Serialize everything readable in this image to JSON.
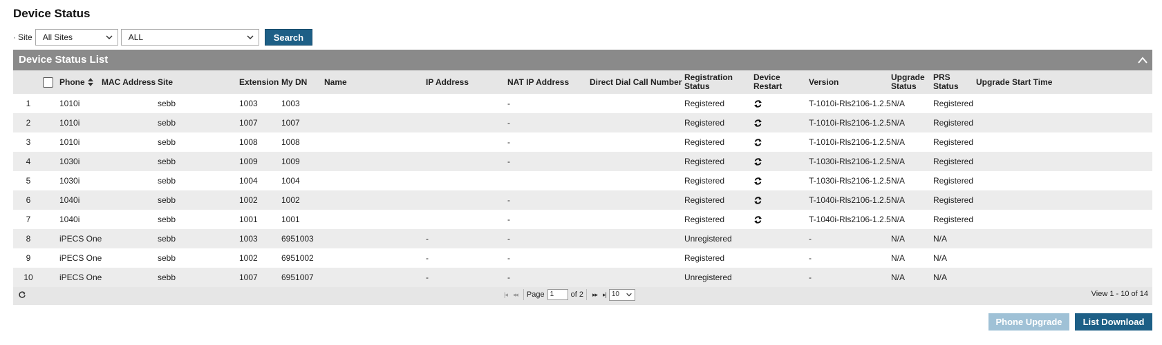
{
  "page": {
    "title": "Device Status"
  },
  "filter": {
    "bullet": "·",
    "site_label": "Site",
    "site_select": "All Sites",
    "scope_select": "ALL",
    "search_label": "Search"
  },
  "grid": {
    "caption": "Device Status List",
    "columns": {
      "phone": "Phone",
      "mac": "MAC Address",
      "site": "Site",
      "extension": "Extension",
      "my_dn": "My DN",
      "name": "Name",
      "ip": "IP Address",
      "nat_ip": "NAT IP Address",
      "direct_dial": "Direct Dial Call Number",
      "reg_status": "Registration Status",
      "device_restart": "Device Restart",
      "version": "Version",
      "upgrade_status": "Upgrade Status",
      "prs_status": "PRS Status",
      "upgrade_start": "Upgrade Start Time"
    },
    "rows": [
      {
        "num": "1",
        "phone": "1010i",
        "site": "sebb",
        "ext": "1003",
        "dn": "1003",
        "ip": "",
        "nat": "-",
        "reg": "Registered",
        "restart": true,
        "version": "T-1010i-Rls2106-1.2.5",
        "upg": "N/A",
        "prs": "Registered"
      },
      {
        "num": "2",
        "phone": "1010i",
        "site": "sebb",
        "ext": "1007",
        "dn": "1007",
        "ip": "",
        "nat": "-",
        "reg": "Registered",
        "restart": true,
        "version": "T-1010i-Rls2106-1.2.5",
        "upg": "N/A",
        "prs": "Registered"
      },
      {
        "num": "3",
        "phone": "1010i",
        "site": "sebb",
        "ext": "1008",
        "dn": "1008",
        "ip": "",
        "nat": "-",
        "reg": "Registered",
        "restart": true,
        "version": "T-1010i-Rls2106-1.2.5",
        "upg": "N/A",
        "prs": "Registered"
      },
      {
        "num": "4",
        "phone": "1030i",
        "site": "sebb",
        "ext": "1009",
        "dn": "1009",
        "ip": "",
        "nat": "-",
        "reg": "Registered",
        "restart": true,
        "version": "T-1030i-Rls2106-1.2.5",
        "upg": "N/A",
        "prs": "Registered"
      },
      {
        "num": "5",
        "phone": "1030i",
        "site": "sebb",
        "ext": "1004",
        "dn": "1004",
        "ip": "",
        "nat": "",
        "reg": "Registered",
        "restart": true,
        "version": "T-1030i-Rls2106-1.2.5",
        "upg": "N/A",
        "prs": "Registered"
      },
      {
        "num": "6",
        "phone": "1040i",
        "site": "sebb",
        "ext": "1002",
        "dn": "1002",
        "ip": "",
        "nat": "-",
        "reg": "Registered",
        "restart": true,
        "version": "T-1040i-Rls2106-1.2.5",
        "upg": "N/A",
        "prs": "Registered"
      },
      {
        "num": "7",
        "phone": "1040i",
        "site": "sebb",
        "ext": "1001",
        "dn": "1001",
        "ip": "",
        "nat": "-",
        "reg": "Registered",
        "restart": true,
        "version": "T-1040i-Rls2106-1.2.5",
        "upg": "N/A",
        "prs": "Registered"
      },
      {
        "num": "8",
        "phone": "iPECS One",
        "site": "sebb",
        "ext": "1003",
        "dn": "6951003",
        "ip": "-",
        "nat": "-",
        "reg": "Unregistered",
        "restart": false,
        "version": "-",
        "upg": "N/A",
        "prs": "N/A"
      },
      {
        "num": "9",
        "phone": "iPECS One",
        "site": "sebb",
        "ext": "1002",
        "dn": "6951002",
        "ip": "-",
        "nat": "-",
        "reg": "Registered",
        "restart": false,
        "version": "-",
        "upg": "N/A",
        "prs": "N/A"
      },
      {
        "num": "10",
        "phone": "iPECS One",
        "site": "sebb",
        "ext": "1007",
        "dn": "6951007",
        "ip": "-",
        "nat": "-",
        "reg": "Unregistered",
        "restart": false,
        "version": "-",
        "upg": "N/A",
        "prs": "N/A"
      }
    ],
    "pager": {
      "page_label": "Page",
      "page_value": "1",
      "of_label": "of 2",
      "rows_per_page": "10",
      "view_info": "View 1 - 10 of 14"
    }
  },
  "actions": {
    "phone_upgrade": "Phone Upgrade",
    "list_download": "List Download"
  },
  "colors": {
    "primary": "#1d5f86",
    "primary_disabled": "#9fc1d6",
    "caption_bg": "#8a8a8a",
    "header_bg": "#e6e6e6"
  },
  "icons": {
    "restart": "refresh-icon",
    "collapse": "chevron-up-icon",
    "sort": "sort-icon"
  }
}
